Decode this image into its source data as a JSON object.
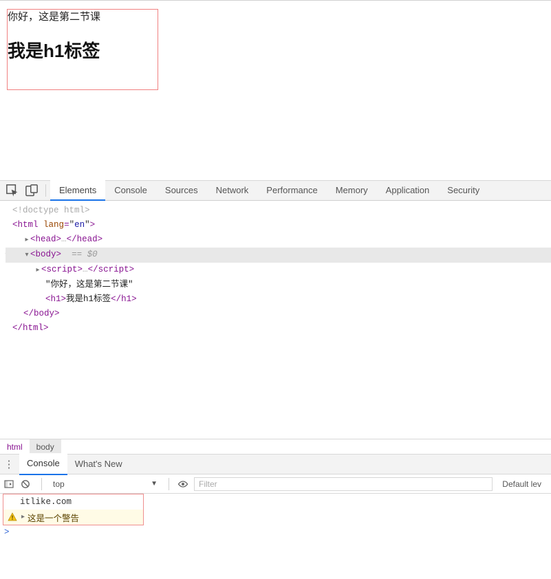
{
  "page": {
    "text_line": "你好，这是第二节课",
    "h1": "我是h1标签"
  },
  "devtools": {
    "tabs": [
      "Elements",
      "Console",
      "Sources",
      "Network",
      "Performance",
      "Memory",
      "Application",
      "Security"
    ],
    "active_tab": 0
  },
  "dom": {
    "doctype": "<!doctype html>",
    "html_open": "html",
    "html_attr_name": "lang",
    "html_attr_val": "en",
    "head": "head",
    "head_ellipsis": "…",
    "body": "body",
    "body_marker": "== $0",
    "script": "script",
    "script_ellipsis": "…",
    "text_quoted": "\"你好，这是第二节课\"",
    "h1_tag": "h1",
    "h1_text": "我是h1标签",
    "body_close": "body",
    "html_close": "html"
  },
  "crumbs": {
    "a": "html",
    "b": "body"
  },
  "drawer": {
    "tabs": [
      "Console",
      "What's New"
    ],
    "active": 0
  },
  "console_toolbar": {
    "context": "top",
    "filter_placeholder": "Filter",
    "levels": "Default lev"
  },
  "console": {
    "log1": "itlike.com",
    "warn1": "这是一个警告",
    "prompt": ">"
  }
}
